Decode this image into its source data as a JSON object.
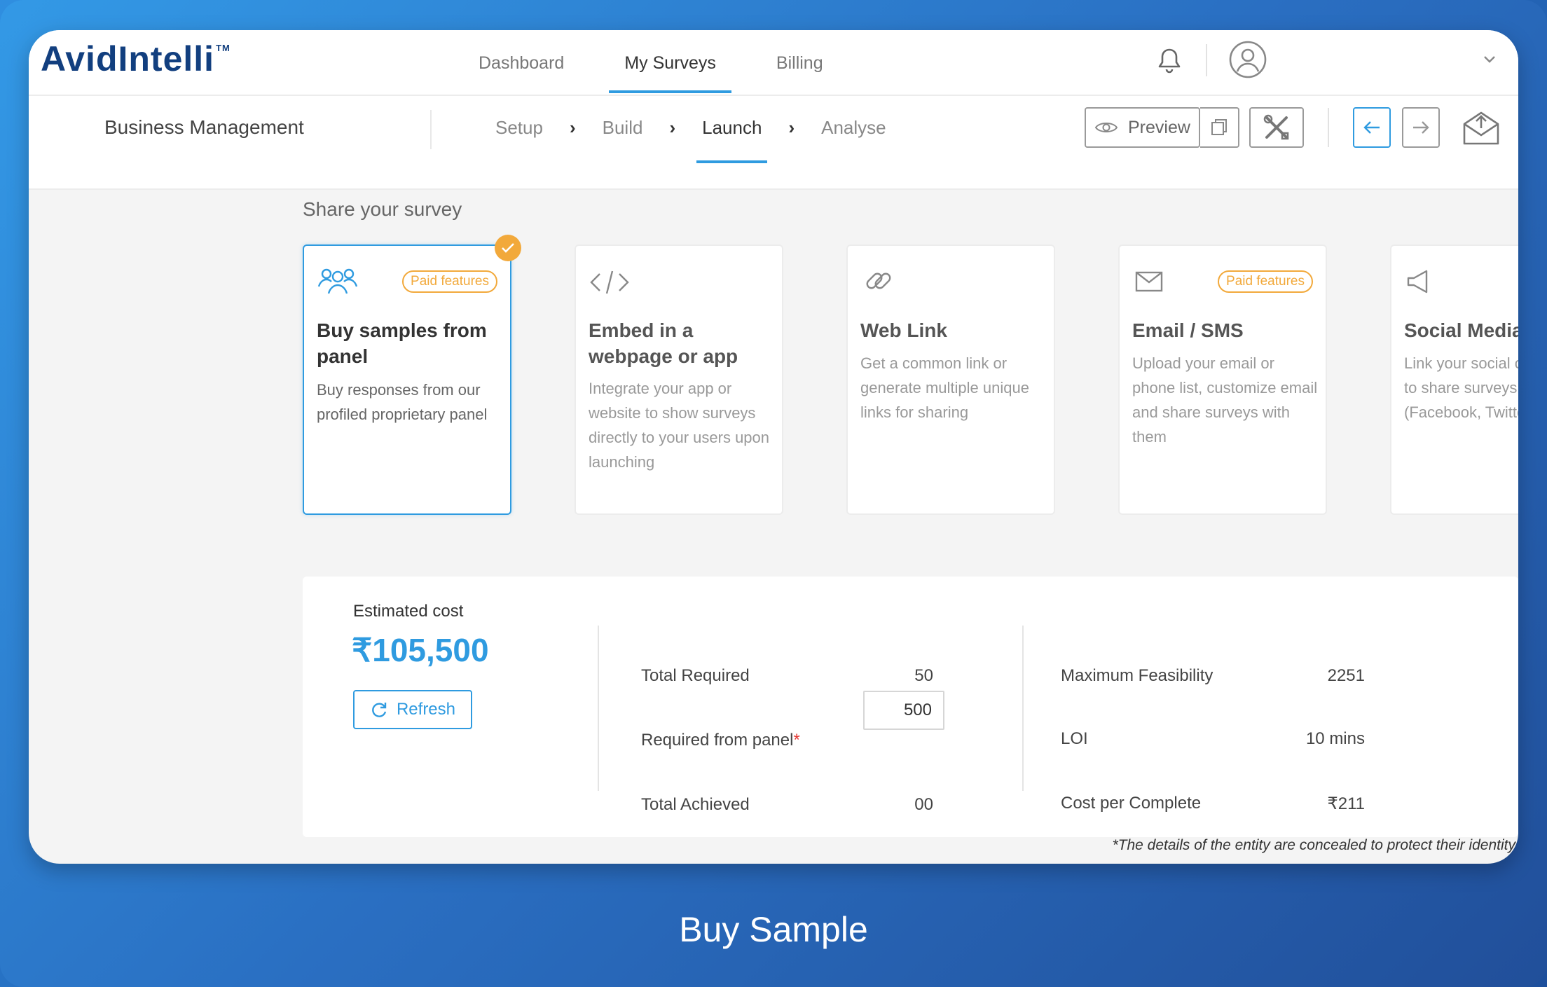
{
  "app": {
    "logo": "AvidIntelli",
    "logo_tm": "TM"
  },
  "nav": {
    "tabs": [
      {
        "label": "Dashboard",
        "active": false
      },
      {
        "label": "My Surveys",
        "active": true
      },
      {
        "label": "Billing",
        "active": false
      }
    ]
  },
  "project": {
    "name": "Business Management"
  },
  "steps": [
    {
      "label": "Setup",
      "active": false
    },
    {
      "label": "Build",
      "active": false
    },
    {
      "label": "Launch",
      "active": true
    },
    {
      "label": "Analyse",
      "active": false
    }
  ],
  "toolbar": {
    "preview_label": "Preview"
  },
  "share": {
    "title": "Share your survey",
    "cards": [
      {
        "title": "Buy samples from panel",
        "desc": "Buy responses from our profiled proprietary panel",
        "badge": "Paid features",
        "selected": true,
        "icon": "users-icon"
      },
      {
        "title": "Embed in a webpage or app",
        "desc": "Integrate your app or website to show surveys directly to your users upon launching",
        "badge": "",
        "selected": false,
        "icon": "code-icon"
      },
      {
        "title": "Web Link",
        "desc": "Get a common link or generate multiple unique links for sharing",
        "badge": "",
        "selected": false,
        "icon": "link-icon"
      },
      {
        "title": "Email / SMS",
        "desc": "Upload your email or phone list, customize email and share surveys with them",
        "badge": "Paid features",
        "selected": false,
        "icon": "mail-icon"
      },
      {
        "title": "Social Media",
        "desc": "Link your social channels to share surveys instantly (Facebook, Twitter etc.,)",
        "badge": "",
        "selected": false,
        "icon": "megaphone-icon"
      }
    ]
  },
  "cost": {
    "label": "Estimated cost",
    "amount": "₹105,500",
    "refresh_label": "Refresh",
    "total_required_label": "Total Required",
    "total_required_value": "50",
    "required_from_panel_label": "Required from panel",
    "required_star": "*",
    "required_from_panel_value": "500",
    "total_achieved_label": "Total Achieved",
    "total_achieved_value": "00",
    "max_feasibility_label": "Maximum Feasibility",
    "max_feasibility_value": "2251",
    "loi_label": "LOI",
    "loi_value": "10 mins",
    "cpc_label": "Cost per Complete",
    "cpc_value": "₹211"
  },
  "footnote": "*The details of the entity are concealed to protect their identity",
  "caption": "Buy Sample",
  "colors": {
    "accent": "#2f9be0",
    "paid_badge": "#f2a93b",
    "logo": "#123f7f",
    "background_gradient_start": "#3399e6",
    "background_gradient_end": "#214f9a"
  }
}
